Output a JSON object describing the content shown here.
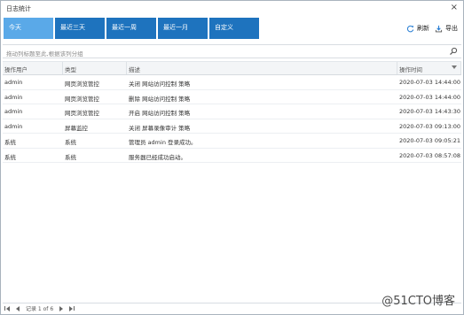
{
  "window": {
    "title": "日志统计",
    "close_glyph": "×"
  },
  "tabs": [
    {
      "label": "今天",
      "active": true
    },
    {
      "label": "最近三天",
      "active": false
    },
    {
      "label": "最近一周",
      "active": false
    },
    {
      "label": "最近一月",
      "active": false
    },
    {
      "label": "自定义",
      "active": false
    }
  ],
  "toolbar": {
    "refresh_label": "刷新",
    "export_label": "导出"
  },
  "search": {
    "placeholder": "拖动列标题至此,根据该列分组"
  },
  "table": {
    "headers": [
      "操作用户",
      "类型",
      "描述",
      "操作时间"
    ],
    "rows": [
      [
        "admin",
        "网页浏览管控",
        "关闭 网站访问控制 策略",
        "2020-07-03 14:44:00"
      ],
      [
        "admin",
        "网页浏览管控",
        "删除 网站访问控制 策略",
        "2020-07-03 14:44:00"
      ],
      [
        "admin",
        "网页浏览管控",
        "开启 网站访问控制 策略",
        "2020-07-03 14:43:30"
      ],
      [
        "admin",
        "屏幕监控",
        "关闭 屏幕录像审计 策略",
        "2020-07-03 09:13:00"
      ],
      [
        "系统",
        "系统",
        "管理员 admin 登录成功。",
        "2020-07-03 09:05:21"
      ],
      [
        "系统",
        "系统",
        "服务器已经成功启动。",
        "2020-07-03 08:57:08"
      ]
    ]
  },
  "footer": {
    "records_text": "记录 1 of 6"
  },
  "watermark": {
    "text": "@51CTO博客"
  },
  "colors": {
    "tab_bg": "#1e73be",
    "tab_active_bg": "#5aa9e8",
    "header_bg": "#f3f5f7"
  }
}
